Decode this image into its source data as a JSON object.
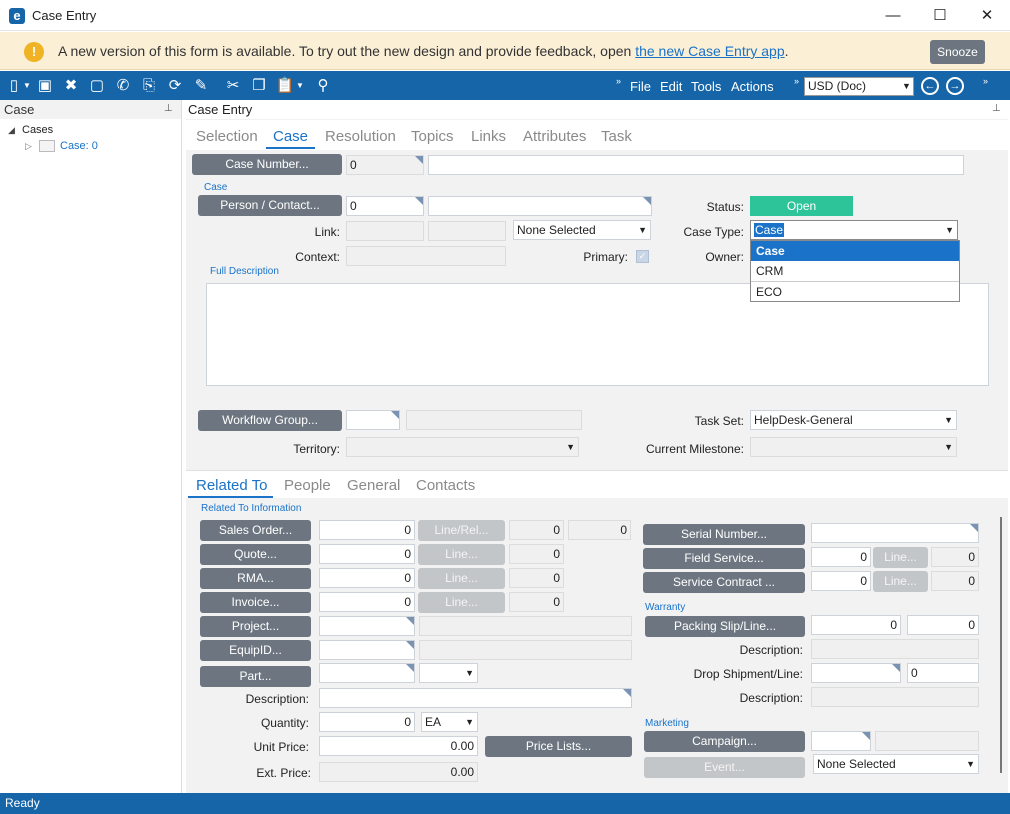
{
  "window": {
    "title": "Case Entry",
    "minimize": "—",
    "maximize": "☐",
    "close": "✕"
  },
  "banner": {
    "text": "A new version of this form is available. To try out the new design and provide feedback, open ",
    "link": "the new Case Entry app",
    "suffix": ".",
    "snooze": "Snooze"
  },
  "toolbar": {
    "menus": [
      "File",
      "Edit",
      "Tools",
      "Actions"
    ],
    "currency": "USD (Doc)"
  },
  "left_pane": {
    "title": "Case",
    "tree_root": "Cases",
    "tree_child": "Case: 0"
  },
  "main": {
    "title": "Case Entry",
    "tabs": [
      "Selection",
      "Case",
      "Resolution",
      "Topics",
      "Links",
      "Attributes",
      "Task"
    ],
    "case_number_btn": "Case Number...",
    "case_number_value": "0",
    "section_case": "Case",
    "person_contact_btn": "Person / Contact...",
    "person_value": "0",
    "link_label": "Link:",
    "link_select": "None Selected",
    "context_label": "Context:",
    "primary_label": "Primary:",
    "status_label": "Status:",
    "status_value": "Open",
    "case_type_label": "Case Type:",
    "case_type_value": "Case",
    "owner_label": "Owner:",
    "case_type_options": [
      "Case",
      "CRM",
      "ECO"
    ],
    "full_description": "Full Description",
    "workflow_btn": "Workflow Group...",
    "territory_label": "Territory:",
    "task_set_label": "Task Set:",
    "task_set_value": "HelpDesk-General",
    "current_milestone_label": "Current Milestone:"
  },
  "lower": {
    "tabs": [
      "Related To",
      "People",
      "General",
      "Contacts"
    ],
    "section_related": "Related To Information",
    "sales_order_btn": "Sales Order...",
    "quote_btn": "Quote...",
    "rma_btn": "RMA...",
    "invoice_btn": "Invoice...",
    "project_btn": "Project...",
    "equipid_btn": "EquipID...",
    "part_btn": "Part...",
    "line_rel_btn": "Line/Rel...",
    "line_btn": "Line...",
    "zero": "0",
    "description_label": "Description:",
    "quantity_label": "Quantity:",
    "quantity_value": "0",
    "uom_value": "EA",
    "unit_price_label": "Unit Price:",
    "unit_price_value": "0.00",
    "ext_price_label": "Ext. Price:",
    "ext_price_value": "0.00",
    "price_lists_btn": "Price Lists...",
    "serial_btn": "Serial Number...",
    "field_service_btn": "Field Service...",
    "service_contract_btn": "Service Contract ...",
    "section_warranty": "Warranty",
    "packing_btn": "Packing Slip/Line...",
    "drop_ship_label": "Drop Shipment/Line:",
    "section_marketing": "Marketing",
    "campaign_btn": "Campaign...",
    "event_btn": "Event...",
    "event_select": "None Selected"
  },
  "status_bar": "Ready"
}
